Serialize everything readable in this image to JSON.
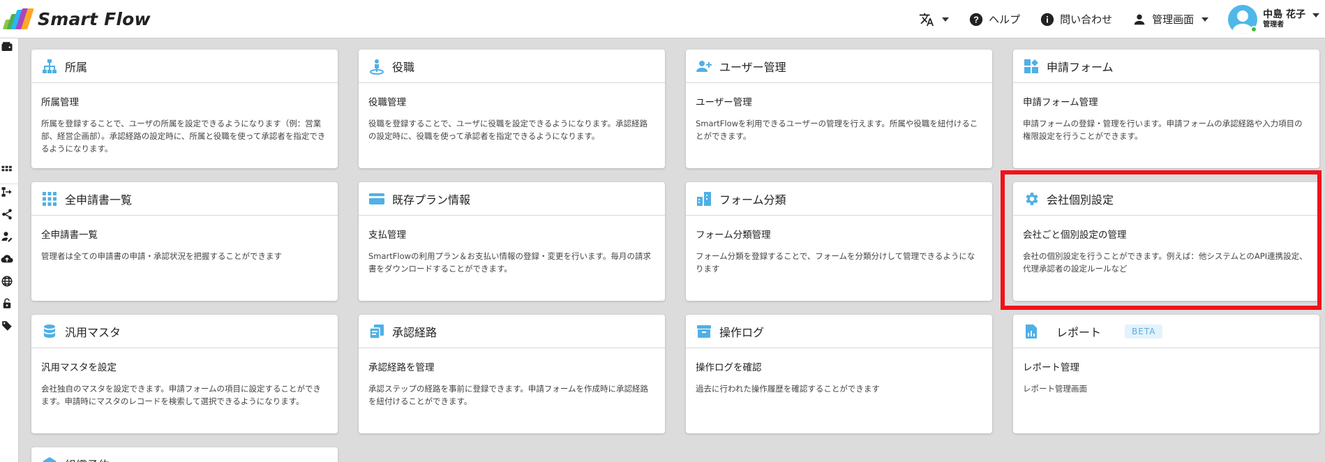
{
  "app": {
    "name": "Smart Flow",
    "logo_colors": [
      "#8bc34a",
      "#4caf50",
      "#29b6f6",
      "#ab47bc",
      "#ffa726"
    ]
  },
  "header": {
    "language_icon": "translate-icon",
    "help_label": "ヘルプ",
    "contact_label": "問い合わせ",
    "admin_label": "管理画面",
    "user": {
      "name": "中島 花子",
      "role": "管理者",
      "status_color": "#3bbf3b"
    }
  },
  "sidebar": {
    "icons": [
      "wallet-icon",
      "grid-icon",
      "flow-icon",
      "share-icon",
      "user-edit-icon",
      "cloud-upload-icon",
      "globe-icon",
      "lock-icon",
      "tag-icon"
    ]
  },
  "cards": [
    {
      "title": "所属",
      "icon": "org-chart-icon",
      "subtitle": "所属管理",
      "description": "所属を登録することで、ユーザの所属を設定できるようになります（例：営業部、経営企画部）。承認経路の設定時に、所属と役職を使って承認者を指定できるようになります。"
    },
    {
      "title": "役職",
      "icon": "person-pin-icon",
      "subtitle": "役職管理",
      "description": "役職を登録することで、ユーザに役職を設定できるようになります。承認経路の設定時に、役職を使って承認者を指定できるようになります。"
    },
    {
      "title": "ユーザー管理",
      "icon": "add-user-icon",
      "subtitle": "ユーザー管理",
      "description": "SmartFlowを利用できるユーザーの管理を行えます。所属や役職を紐付けることができます。"
    },
    {
      "title": "申請フォーム",
      "icon": "widgets-icon",
      "subtitle": "申請フォーム管理",
      "description": "申請フォームの登録・管理を行います。申請フォームの承認経路や入力項目の権限設定を行うことができます。"
    },
    {
      "title": "全申請書一覧",
      "icon": "apps-grid-icon",
      "subtitle": "全申請書一覧",
      "description": "管理者は全ての申請書の申請・承認状況を把握することができます"
    },
    {
      "title": "既存プラン情報",
      "icon": "credit-card-icon",
      "subtitle": "支払管理",
      "description": "SmartFlowの利用プラン＆お支払い情報の登録・変更を行います。毎月の請求書をダウンロードすることができます。"
    },
    {
      "title": "フォーム分類",
      "icon": "category-icon",
      "subtitle": "フォーム分類管理",
      "description": "フォーム分類を登録することで、フォームを分類分けして管理できるようになります"
    },
    {
      "title": "会社個別設定",
      "icon": "gear-icon",
      "subtitle": "会社ごと個別設定の管理",
      "description": "会社の個別設定を行うことができます。例えば：他システムとのAPI連携設定、代理承認者の設定ルールなど"
    },
    {
      "title": "汎用マスタ",
      "icon": "database-icon",
      "subtitle": "汎用マスタを設定",
      "description": "会社独自のマスタを設定できます。申請フォームの項目に設定することができます。申請時にマスタのレコードを検索して選択できるようになります。"
    },
    {
      "title": "承認経路",
      "icon": "copy-icon",
      "subtitle": "承認経路を管理",
      "description": "承認ステップの経路を事前に登録できます。申請フォームを作成時に承認経路を紐付けることができます。"
    },
    {
      "title": "操作ログ",
      "icon": "archive-icon",
      "subtitle": "操作ログを確認",
      "description": "過去に行われた操作履歴を確認することができます"
    },
    {
      "title": "レポート",
      "icon": "report-icon",
      "badge": "BETA",
      "subtitle": "レポート管理",
      "description": "レポート管理画面"
    },
    {
      "title": "組織予約",
      "icon": "layers-icon",
      "subtitle": "",
      "description": ""
    }
  ],
  "accent_color": "#4fb0e6",
  "highlight_color": "#f0121b"
}
